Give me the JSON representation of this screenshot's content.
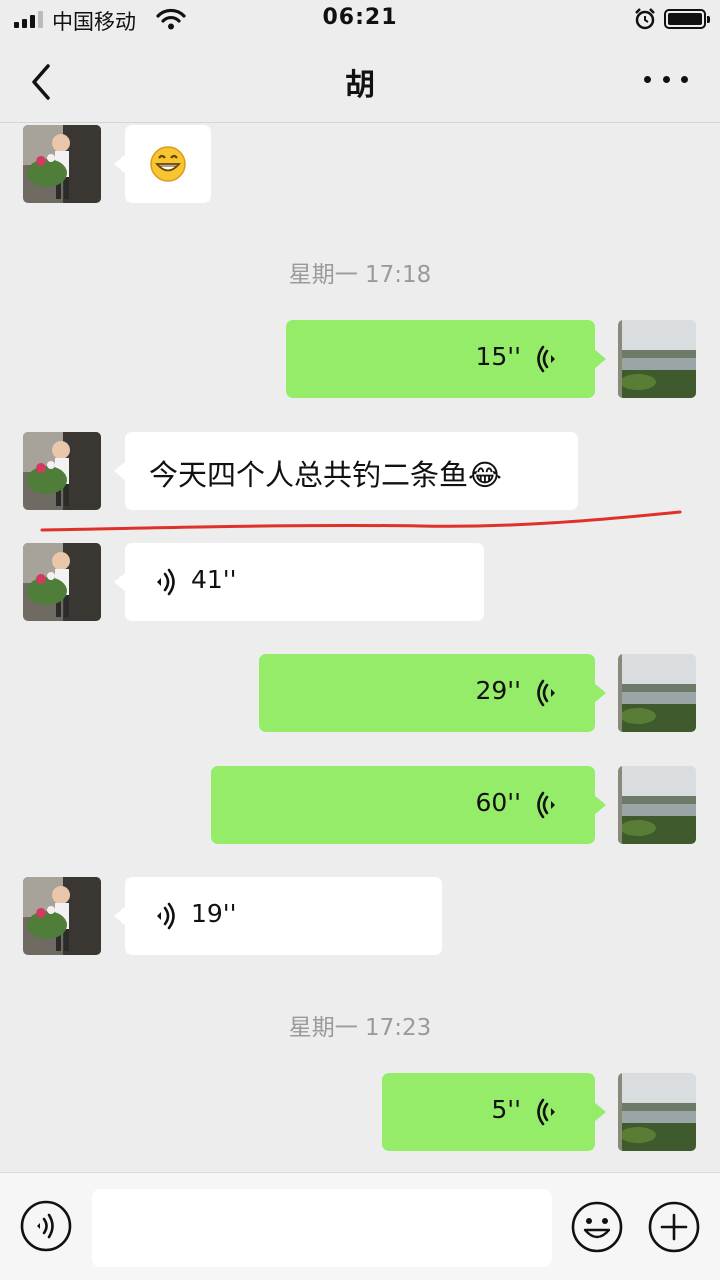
{
  "status_bar": {
    "carrier": "中国移动",
    "time": "06:21",
    "icons": [
      "signal-icon",
      "wifi-icon",
      "alarm-icon",
      "battery-icon"
    ]
  },
  "nav": {
    "title": "胡",
    "back_icon": "chevron-left-icon",
    "more_icon": "more-dots-icon"
  },
  "chat": {
    "timestamps": [
      "星期一 17:18",
      "星期一 17:23"
    ],
    "messages": [
      {
        "side": "in",
        "type": "emoji",
        "emoji": "😁"
      },
      {
        "side": "out",
        "type": "voice",
        "duration": "15''"
      },
      {
        "side": "in",
        "type": "text",
        "text": "今天四个人总共钓二条鱼😂"
      },
      {
        "side": "in",
        "type": "voice",
        "duration": "41''"
      },
      {
        "side": "out",
        "type": "voice",
        "duration": "29''"
      },
      {
        "side": "out",
        "type": "voice",
        "duration": "60''"
      },
      {
        "side": "in",
        "type": "voice",
        "duration": "19''"
      },
      {
        "side": "out",
        "type": "voice",
        "duration": "5''"
      }
    ]
  },
  "input_bar": {
    "voice_icon": "voice-input-icon",
    "emoji_icon": "emoji-icon",
    "plus_icon": "plus-icon",
    "placeholder": ""
  },
  "colors": {
    "background": "#ededed",
    "bubble_out": "#95ec69",
    "bubble_in": "#ffffff",
    "underline_annotation": "#e0302a"
  }
}
